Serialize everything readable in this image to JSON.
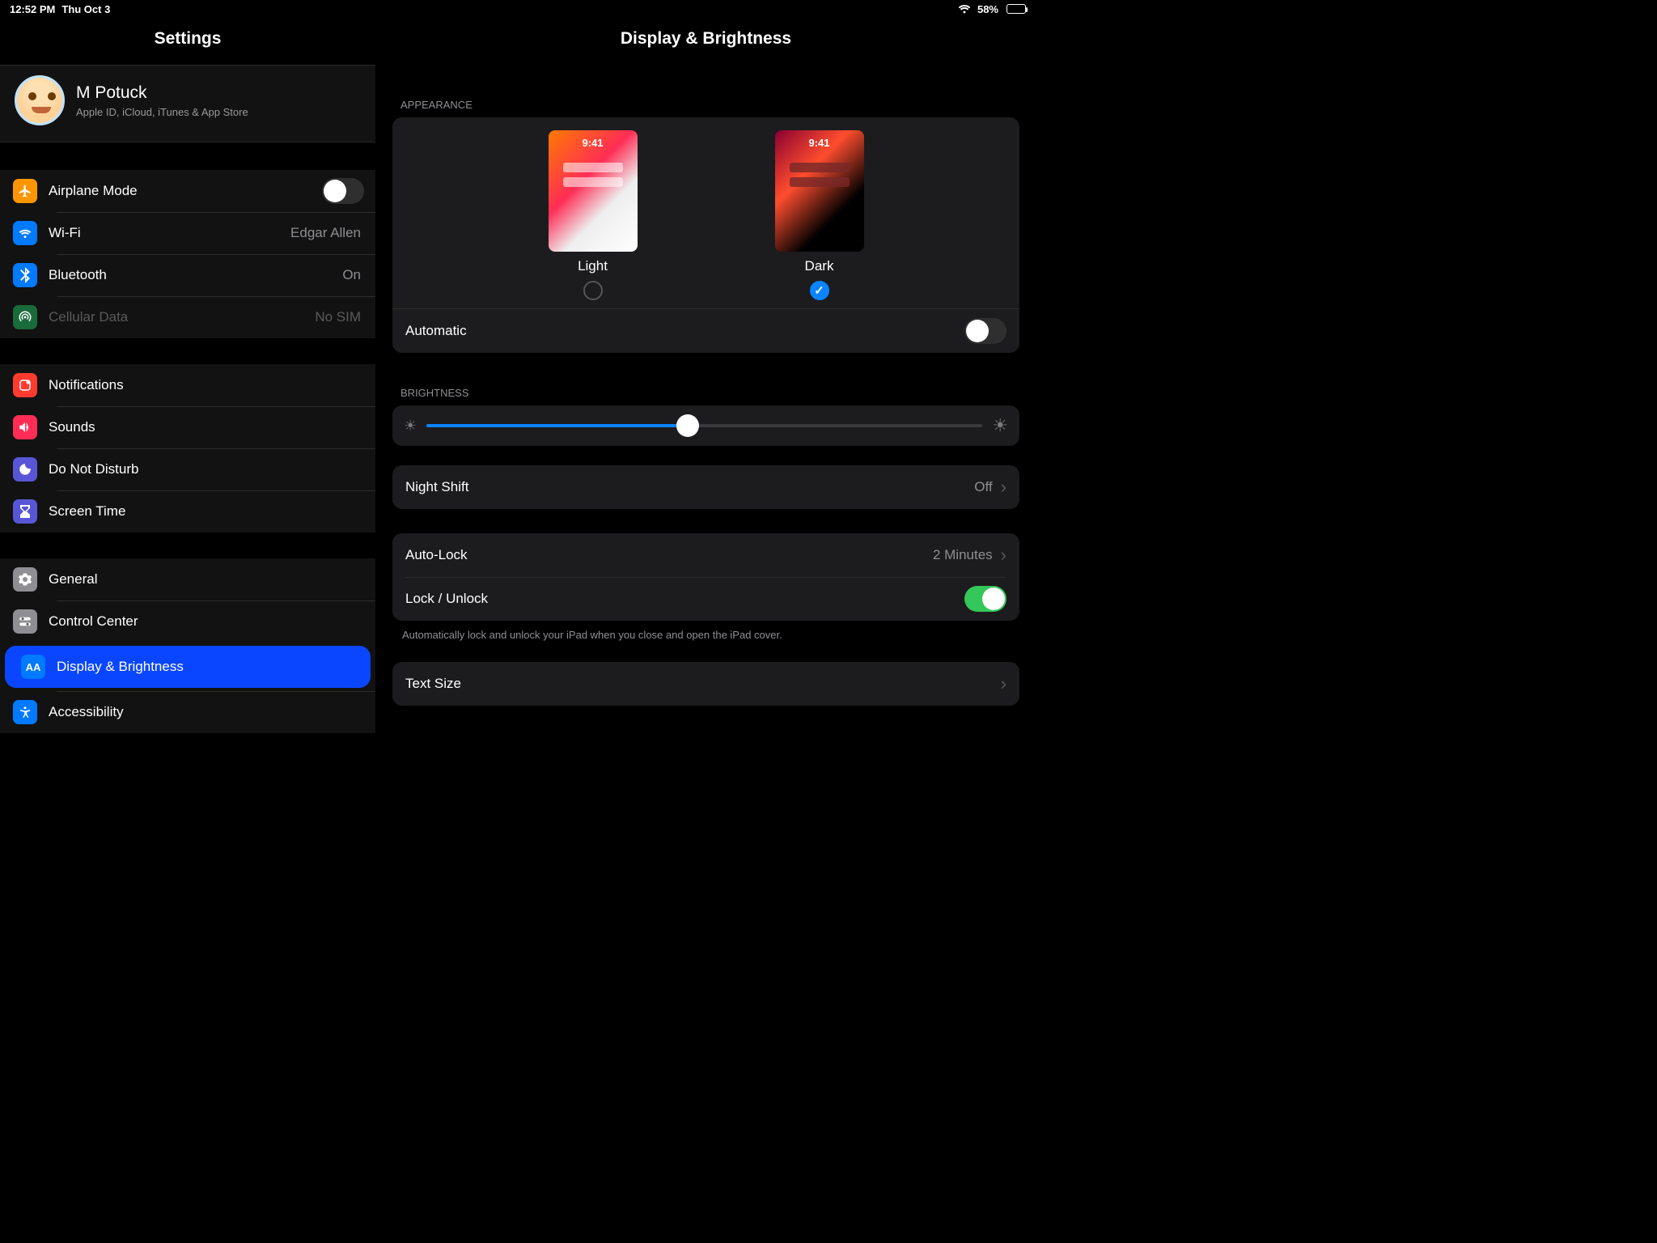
{
  "status": {
    "time": "12:52 PM",
    "date": "Thu Oct 3",
    "battery": "58%"
  },
  "sidebar": {
    "title": "Settings",
    "account": {
      "name": "M Potuck",
      "sub": "Apple ID, iCloud, iTunes & App Store"
    },
    "g1": {
      "airplane": "Airplane Mode",
      "wifi": "Wi-Fi",
      "wifi_val": "Edgar Allen",
      "bt": "Bluetooth",
      "bt_val": "On",
      "cell": "Cellular Data",
      "cell_val": "No SIM"
    },
    "g2": {
      "notif": "Notifications",
      "sounds": "Sounds",
      "dnd": "Do Not Disturb",
      "st": "Screen Time"
    },
    "g3": {
      "gen": "General",
      "cc": "Control Center",
      "disp": "Display & Brightness",
      "acc": "Accessibility"
    }
  },
  "main": {
    "title": "Display & Brightness",
    "appearance_label": "Appearance",
    "light": "Light",
    "dark": "Dark",
    "thumb_time": "9:41",
    "automatic": "Automatic",
    "brightness_label": "Brightness",
    "night_shift": "Night Shift",
    "night_shift_val": "Off",
    "auto_lock": "Auto-Lock",
    "auto_lock_val": "2 Minutes",
    "lock_unlock": "Lock / Unlock",
    "lock_footer": "Automatically lock and unlock your iPad when you close and open the iPad cover.",
    "text_size": "Text Size"
  }
}
